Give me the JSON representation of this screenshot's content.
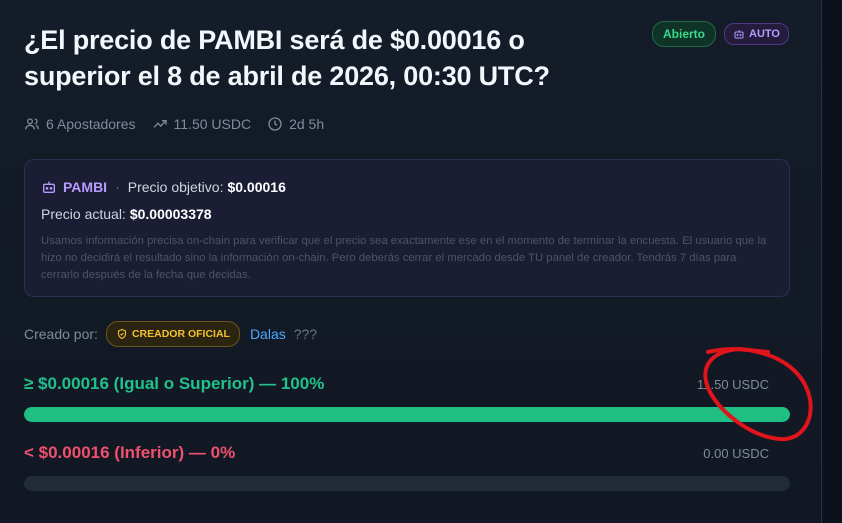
{
  "market": {
    "title": "¿El precio de PAMBI será de $0.00016 o superior el 8 de abril de 2026, 00:30 UTC?",
    "status_badge": "Abierto",
    "mode_badge": "AUTO"
  },
  "stats": {
    "bettors": "6 Apostadores",
    "volume": "11.50 USDC",
    "time_left": "2d 5h"
  },
  "info": {
    "asset": "PAMBI",
    "separator": "·",
    "target_label": "Precio objetivo:",
    "target_value": "$0.00016",
    "current_label": "Precio actual:",
    "current_value": "$0.00003378",
    "note": "Usamos información precisa on-chain para verificar que el precio sea exactamente ese en el momento de terminar la encuesta. El usuario que la hizo no decidirá el resultado sino la información on-chain. Pero deberás cerrar el mercado desde TU panel de creador. Tendrás 7 días para cerrarlo después de la fecha que decidas."
  },
  "creator": {
    "label": "Creado por:",
    "badge": "CREADOR OFICIAL",
    "name": "Dalas",
    "extra": "???"
  },
  "options": [
    {
      "label": "≥ $0.00016 (Igual o Superior) — 100%",
      "amount": "11.50 USDC",
      "percent": 100,
      "color": "#1fbf84"
    },
    {
      "label": "< $0.00016 (Inferior) — 0%",
      "amount": "0.00 USDC",
      "percent": 0,
      "color": "#e0455f"
    }
  ],
  "colors": {
    "accent_green": "#22c08a",
    "accent_red": "#f0506e",
    "accent_purple": "#b69cff",
    "annotation_red": "#e0141b"
  },
  "icons": [
    "users-icon",
    "trending-up-icon",
    "clock-icon",
    "robot-icon",
    "shield-check-icon"
  ]
}
